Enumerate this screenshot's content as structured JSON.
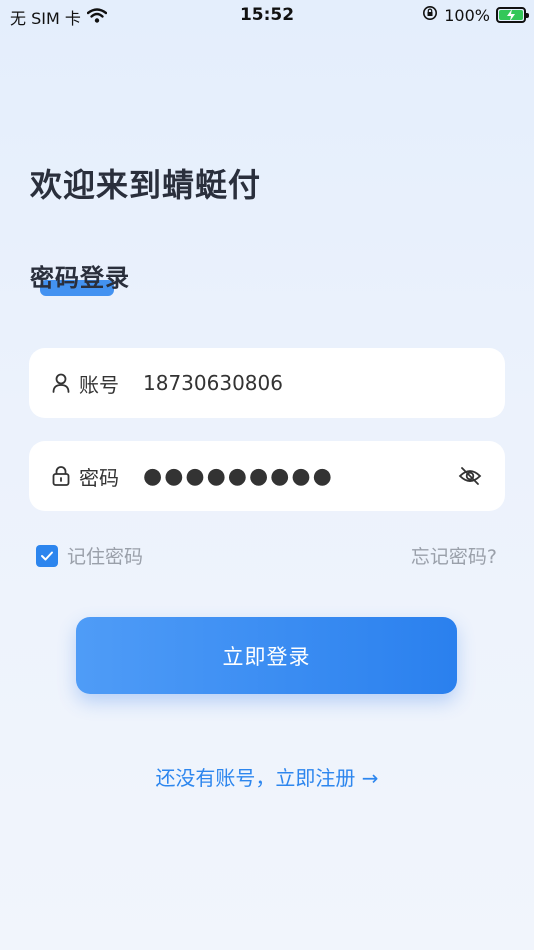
{
  "status_bar": {
    "carrier": "无 SIM 卡",
    "time": "15:52",
    "battery": "100%"
  },
  "welcome_text": "欢迎来到蜻蜓付",
  "login_title": "密码登录",
  "account": {
    "label": "账号",
    "value": "18730630806"
  },
  "password": {
    "label": "密码",
    "masked_value": "●●●●●●●●●"
  },
  "remember": {
    "label": "记住密码",
    "checked": true
  },
  "forgot_label": "忘记密码?",
  "login_button": "立即登录",
  "register_link": "还没有账号，立即注册 →",
  "colors": {
    "accent": "#2c85ee",
    "button_start": "#4f9cf7",
    "button_end": "#2a80ee",
    "battery": "#34c759"
  },
  "icons": [
    "wifi-icon",
    "orientation-lock-icon",
    "battery-icon",
    "user-icon",
    "lock-icon",
    "eye-off-icon",
    "check-icon"
  ]
}
